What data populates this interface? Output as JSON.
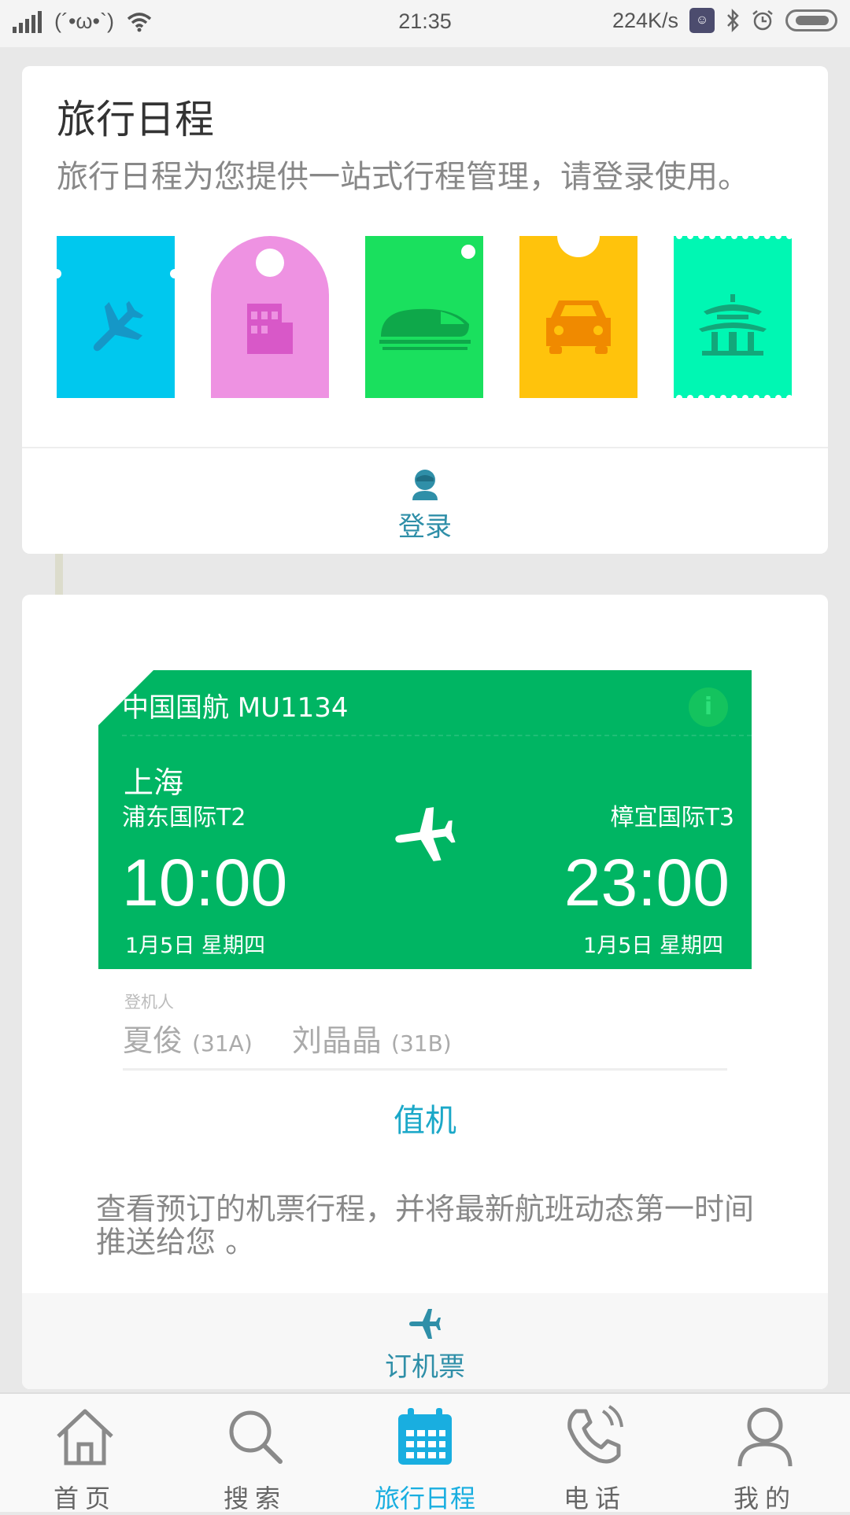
{
  "status_bar": {
    "kaomoji": "(´•ω•`)",
    "time": "21:35",
    "net_speed": "224K/s"
  },
  "trip_card": {
    "title": "旅行日程",
    "subtitle": "旅行日程为您提供一站式行程管理，请登录使用。",
    "tickets": [
      {
        "icon": "plane-icon",
        "color": "#00c8ee"
      },
      {
        "icon": "hotel-icon",
        "color": "#ee92e2"
      },
      {
        "icon": "train-icon",
        "color": "#1ae05e"
      },
      {
        "icon": "car-icon",
        "color": "#ffc30c"
      },
      {
        "icon": "pagoda-icon",
        "color": "#00f7b3"
      }
    ],
    "login_label": "登录"
  },
  "flight_card": {
    "airline": "中国国航  MU1134",
    "dep_city": "上海",
    "dep_terminal": "浦东国际T2",
    "arr_terminal": "樟宜国际T3",
    "dep_time": "10:00",
    "arr_time": "23:00",
    "dep_date": "1月5日   星期四",
    "arr_date": "1月5日     星期四",
    "passenger_label": "登机人",
    "passengers": [
      {
        "name": "夏俊",
        "seat": "(31A)"
      },
      {
        "name": "刘晶晶",
        "seat": "(31B)"
      }
    ],
    "checkin_label": "值机",
    "description": "查看预订的机票行程，并将最新航班动态第一时间推送给您 。",
    "book_label": "订机票",
    "colors": {
      "card": "#00b563",
      "accent": "#1ba8c8"
    }
  },
  "bottom_nav": {
    "items": [
      {
        "label": "首页",
        "icon": "home-icon"
      },
      {
        "label": "搜索",
        "icon": "search-icon"
      },
      {
        "label": "旅行日程",
        "icon": "calendar-icon",
        "active": true
      },
      {
        "label": "电话",
        "icon": "phone-icon"
      },
      {
        "label": "我的",
        "icon": "user-icon"
      }
    ],
    "active_color": "#19aee0"
  }
}
